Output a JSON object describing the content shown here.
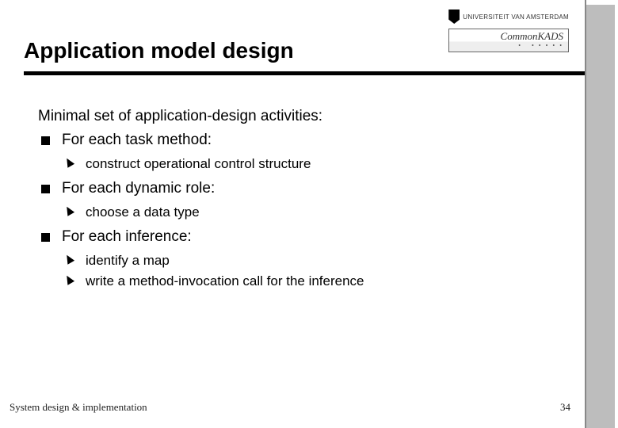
{
  "header": {
    "title": "Application model design",
    "institution": "UNIVERSITEIT VAN AMSTERDAM",
    "brand": "CommonKADS"
  },
  "content": {
    "intro": "Minimal set of application-design activities:",
    "items": [
      {
        "label": "For each task method:",
        "subs": [
          "construct operational control structure"
        ]
      },
      {
        "label": "For each dynamic role:",
        "subs": [
          "choose a data type"
        ]
      },
      {
        "label": "For each inference:",
        "subs": [
          "identify a map",
          "write a method-invocation call for the inference"
        ]
      }
    ]
  },
  "footer": {
    "left": "System design & implementation",
    "page": "34"
  }
}
